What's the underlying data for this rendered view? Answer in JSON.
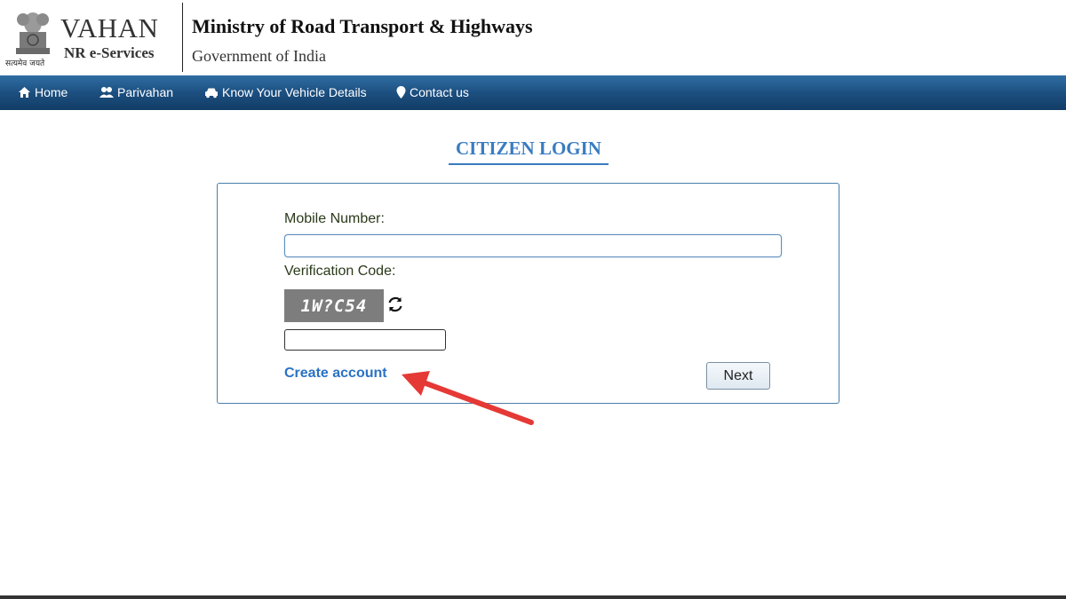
{
  "header": {
    "emblem_motto": "सत्यमेव जयते",
    "brand_title": "VAHAN",
    "brand_subtitle": "NR e-Services",
    "ministry": "Ministry of Road Transport & Highways",
    "government": "Government of India"
  },
  "nav": {
    "items": [
      {
        "label": "Home",
        "icon": "home-icon"
      },
      {
        "label": "Parivahan",
        "icon": "users-icon"
      },
      {
        "label": "Know Your Vehicle Details",
        "icon": "car-icon"
      },
      {
        "label": "Contact us",
        "icon": "map-marker-icon"
      }
    ]
  },
  "login": {
    "title": "CITIZEN LOGIN",
    "mobile_label": "Mobile Number:",
    "mobile_value": "",
    "verification_label": "Verification Code:",
    "captcha_text": "1W?C54",
    "verification_value": "",
    "create_account_label": "Create account",
    "next_label": "Next"
  },
  "colors": {
    "nav_bg": "#1c4f80",
    "title_color": "#3a7cc0",
    "link_color": "#2a72c4",
    "arrow_color": "#e53935"
  }
}
